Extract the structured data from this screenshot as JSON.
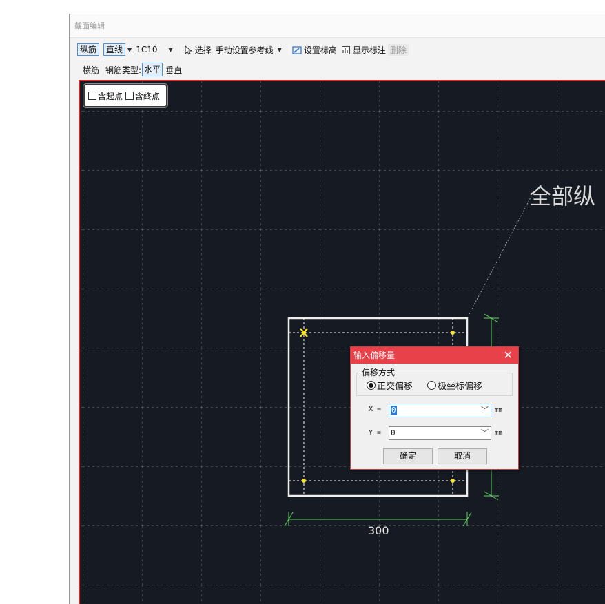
{
  "window": {
    "title": "截面编辑"
  },
  "toolbar1": {
    "longitudinal": "纵筋",
    "line": "直线",
    "rebar": "1C10",
    "select": "选择",
    "manual_ref": "手动设置参考线",
    "set_elevation": "设置标高",
    "show_dimension": "显示标注",
    "delete": "删除"
  },
  "toolbar2": {
    "transverse": "横筋",
    "rebar_type_label": "钢筋类型:",
    "horizontal": "水平",
    "vertical": "垂直"
  },
  "canvas": {
    "include_start": "含起点",
    "include_end": "含终点",
    "annotation": "全部纵",
    "dimension": "300"
  },
  "dialog": {
    "title": "输入偏移量",
    "group_label": "偏移方式",
    "orthogonal": "正交偏移",
    "polar": "极坐标偏移",
    "x_label": "X =",
    "x_value": "0",
    "y_label": "Y =",
    "y_value": "0",
    "unit": "mm",
    "ok": "确定",
    "cancel": "取消"
  },
  "colors": {
    "accent_red": "#e8414a",
    "canvas_bg": "#161a22",
    "dim_green": "#5fd35f",
    "point_yellow": "#f2e22e"
  }
}
